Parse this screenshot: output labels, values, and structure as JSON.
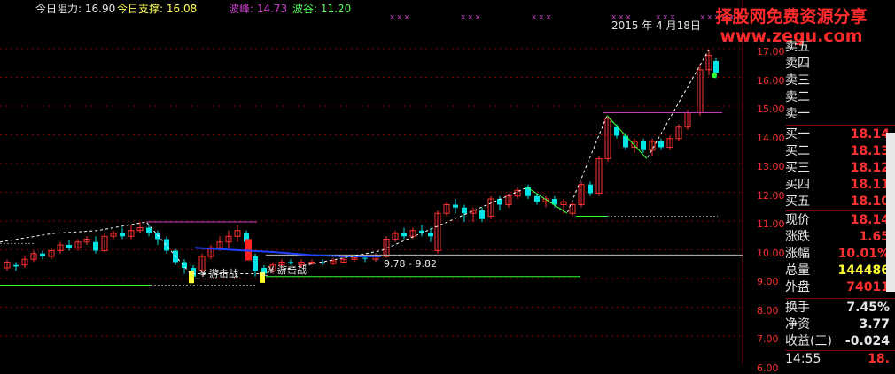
{
  "indicators": {
    "resistance_label": "今日阻力: 16.90",
    "support_label": "今日支撑: 16.08",
    "peak_label": "波峰: 14.73",
    "trough_label": "波谷: 11.20"
  },
  "header_date": "2015 年 4 月18日",
  "watermark": {
    "line1": "择股网免费资源分享",
    "line2": "www.zegu.com"
  },
  "annotations": {
    "guerrilla_1": "_¥ 游击战",
    "guerrilla_2": "_¥ 游击战",
    "range": "9.78 - 9.82"
  },
  "price_axis": [
    "17.00",
    "16.00",
    "15.00",
    "14.00",
    "13.00",
    "12.00",
    "11.00",
    "10.00",
    "9.00",
    "8.00",
    "7.00",
    "6.00"
  ],
  "order_book": {
    "sells": [
      {
        "label": "卖五",
        "value": ""
      },
      {
        "label": "卖四",
        "value": ""
      },
      {
        "label": "卖三",
        "value": ""
      },
      {
        "label": "卖二",
        "value": ""
      },
      {
        "label": "卖一",
        "value": ""
      }
    ],
    "buys": [
      {
        "label": "买一",
        "value": "18.14"
      },
      {
        "label": "买二",
        "value": "18.13"
      },
      {
        "label": "买三",
        "value": "18.12"
      },
      {
        "label": "买四",
        "value": "18.11"
      },
      {
        "label": "买五",
        "value": "18.10"
      }
    ]
  },
  "quote": [
    {
      "label": "现价",
      "value": "18.14",
      "color": "#ff3030"
    },
    {
      "label": "涨跌",
      "value": "1.65",
      "color": "#ff3030"
    },
    {
      "label": "涨幅",
      "value": "10.01%",
      "color": "#ff3030"
    },
    {
      "label": "总量",
      "value": "144486",
      "color": "#ffff33"
    },
    {
      "label": "外盘",
      "value": "74011",
      "color": "#ff3030"
    }
  ],
  "stats": [
    {
      "label": "换手",
      "value": "7.45%",
      "color": "#e6e6e6"
    },
    {
      "label": "净资",
      "value": "3.77",
      "color": "#e6e6e6"
    },
    {
      "label": "收益(三)",
      "value": "-0.024",
      "color": "#e6e6e6"
    }
  ],
  "footer": {
    "time": "14:55",
    "value": "18."
  },
  "colors": {
    "up": "#ff3030",
    "down": "#00e5e5",
    "bg": "#000000",
    "accent": "#c040c0"
  }
}
